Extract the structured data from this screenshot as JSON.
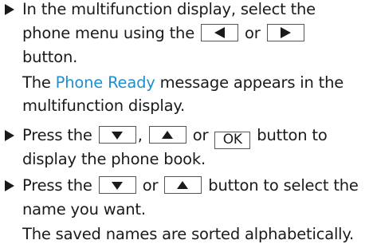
{
  "steps": [
    {
      "lines": [
        "In the multifunction display, select the",
        "phone menu using the",
        "or",
        "button."
      ],
      "result": {
        "before": "The",
        "highlight": "Phone Ready",
        "after": "message appears in the",
        "line2": "multifunction display."
      },
      "keys": [
        "left-arrow",
        "right-arrow"
      ]
    },
    {
      "lines": [
        "Press the",
        ",",
        "or",
        "button to",
        "display the phone book."
      ],
      "keys": [
        "down-arrow",
        "up-arrow",
        "OK"
      ]
    },
    {
      "lines": [
        "Press the",
        "or",
        "button to select the",
        "name you want."
      ],
      "result": {
        "line1": "The saved names are sorted alphabetically."
      },
      "keys": [
        "down-arrow",
        "up-arrow"
      ]
    }
  ],
  "colors": {
    "text": "#1a1a1a",
    "highlight": "#1e8fcf"
  }
}
